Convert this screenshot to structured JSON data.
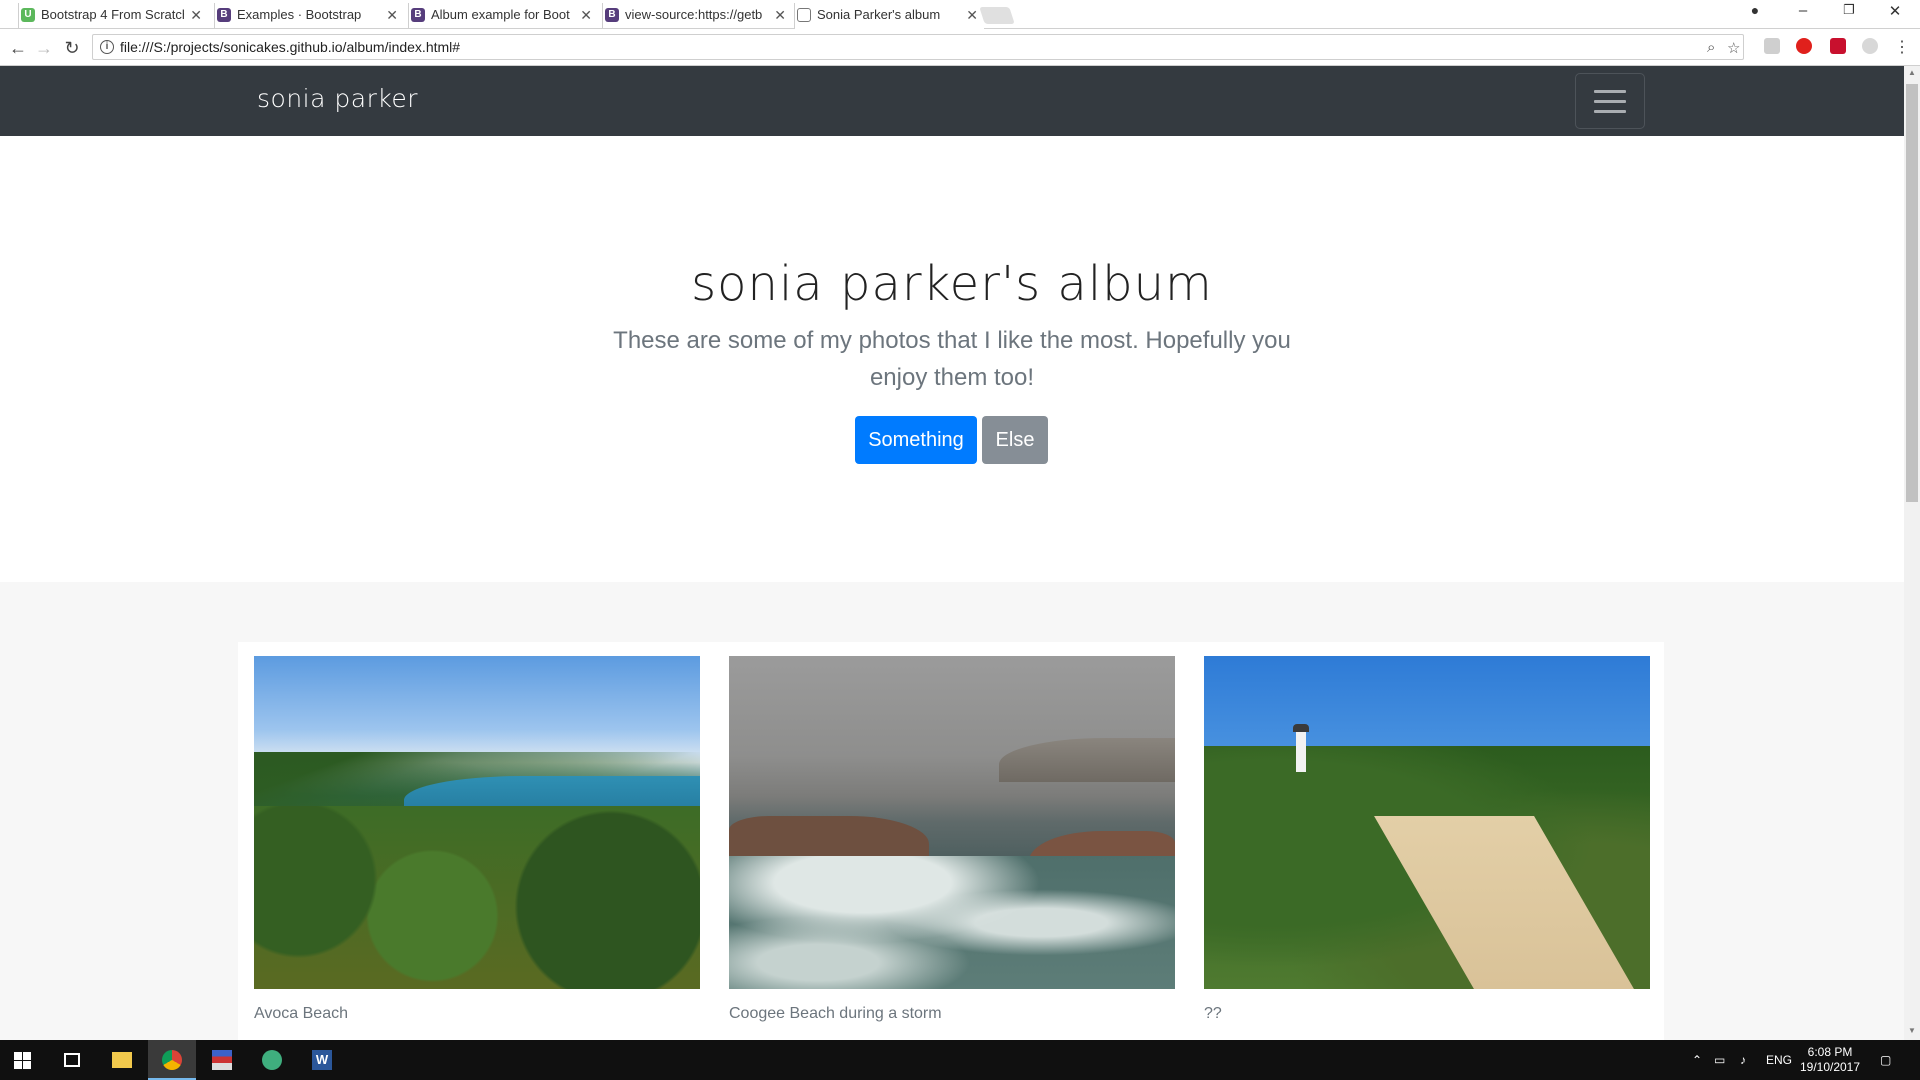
{
  "browser": {
    "tabs": [
      {
        "title": "Bootstrap 4 From Scratch",
        "favicon": "U",
        "favicon_color": "#5cb85c"
      },
      {
        "title": "Examples · Bootstrap",
        "favicon": "B",
        "favicon_color": "#563d7c"
      },
      {
        "title": "Album example for Boot",
        "favicon": "B",
        "favicon_color": "#563d7c"
      },
      {
        "title": "view-source:https://getb",
        "favicon": "B",
        "favicon_color": "#563d7c"
      },
      {
        "title": "Sonia Parker's album",
        "favicon": "page",
        "favicon_color": "#ffffff"
      }
    ],
    "close_glyph": "✕",
    "url": "file:///S:/projects/sonicakes.github.io/album/index.html#"
  },
  "navbar": {
    "brand": "sonia parker"
  },
  "jumbotron": {
    "title": "sonia parker's album",
    "lead": "These are some of my photos that I like the most. Hopefully you enjoy them too!",
    "primary_button": "Something",
    "secondary_button": "Else"
  },
  "album": {
    "cards": [
      {
        "caption": "Avoca Beach"
      },
      {
        "caption": "Coogee Beach during a storm"
      },
      {
        "caption": "??"
      }
    ]
  },
  "taskbar": {
    "language": "ENG",
    "time": "6:08 PM",
    "date": "19/10/2017"
  },
  "colors": {
    "navbar": "#343a40",
    "primary": "#007bff",
    "secondary": "#868e96",
    "muted_text": "#6c757d"
  }
}
